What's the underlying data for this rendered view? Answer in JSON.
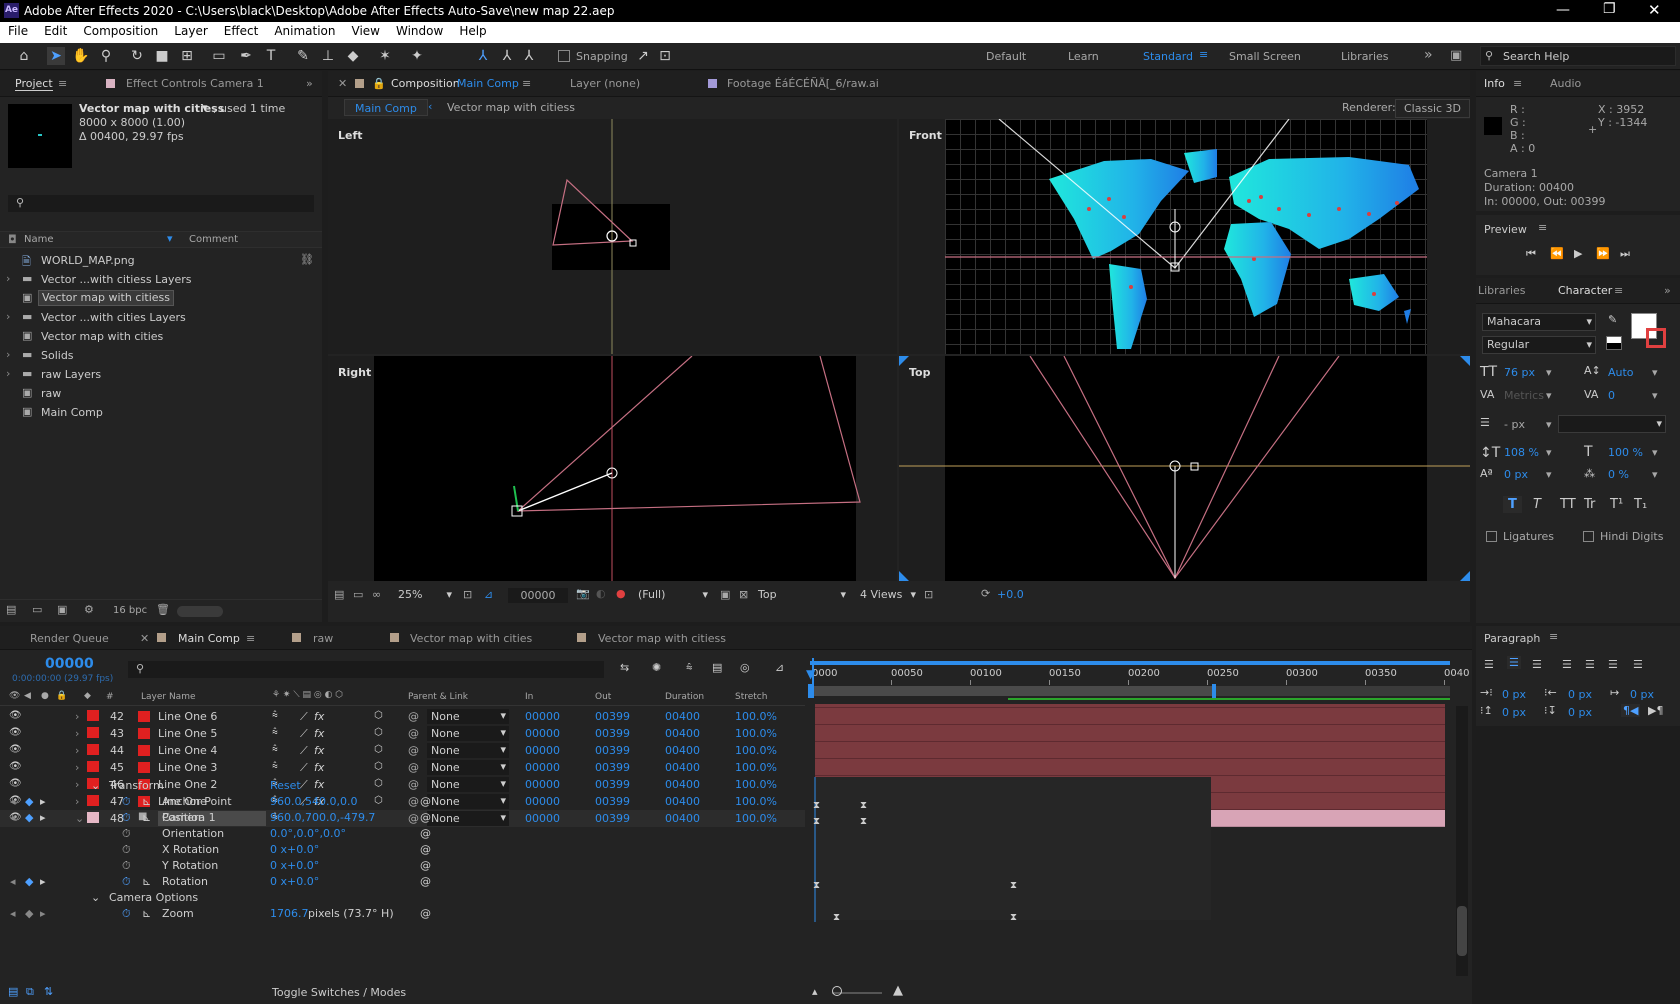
{
  "window": {
    "title": "Adobe After Effects 2020 - C:\\Users\\black\\Desktop\\Adobe After Effects Auto-Save\\new map 22.aep",
    "app_badge": "Ae"
  },
  "menu": [
    "File",
    "Edit",
    "Composition",
    "Layer",
    "Effect",
    "Animation",
    "View",
    "Window",
    "Help"
  ],
  "toolbar": {
    "snapping": "Snapping",
    "workspaces": [
      "Default",
      "Learn",
      "Standard",
      "Small Screen",
      "Libraries"
    ],
    "active_workspace": "Standard",
    "search_placeholder": "Search Help"
  },
  "project": {
    "tab": "Project",
    "effect_controls_tab": "Effect Controls Camera 1",
    "selected_name": "Vector map with citiess",
    "used": ", used 1 time",
    "dims": "8000 x 8000 (1.00)",
    "duration": "Δ 00400, 29.97 fps",
    "col_name": "Name",
    "col_comment": "Comment",
    "items": [
      "WORLD_MAP.png",
      "Vector ...with citiess Layers",
      "Vector map with citiess",
      "Vector ...with cities Layers",
      "Vector map with cities",
      "Solids",
      "raw Layers",
      "raw",
      "Main Comp"
    ],
    "bpc": "16 bpc"
  },
  "composition": {
    "tab_prefix": "Composition",
    "tab_name": "Main Comp",
    "layer_tab": "Layer  (none)",
    "footage_tab": "Footage  ÉáÉCÉÑÄ[_6/raw.ai",
    "crumb1": "Main Comp",
    "crumb2": "Vector map with citiess",
    "renderer_label": "Renderer:",
    "renderer": "Classic 3D",
    "views": [
      "Left",
      "Front",
      "Right",
      "Top"
    ],
    "zoom": "25%",
    "timecode": "00000",
    "resolution": "(Full)",
    "view": "Top",
    "layout": "4 Views",
    "exposure": "+0.0"
  },
  "info": {
    "tab": "Info",
    "audio_tab": "Audio",
    "r": "R :",
    "g": "G :",
    "b": "B :",
    "a": "A :  0",
    "x": "X : 3952",
    "y": "Y : -1344",
    "camera": "Camera 1",
    "duration": "Duration: 00400",
    "inout": "In: 00000, Out: 00399",
    "preview": "Preview"
  },
  "character": {
    "libraries_tab": "Libraries",
    "tab": "Character",
    "font": "Mahacara",
    "style": "Regular",
    "size": "76 px",
    "leading": "Auto",
    "kerning": "Metrics",
    "tracking": "0",
    "stroke": "- px",
    "vscale": "108 %",
    "hscale": "100 %",
    "baseline": "0 px",
    "tsume": "0 %",
    "ligatures": "Ligatures",
    "hindi": "Hindi Digits",
    "styles": [
      "T",
      "T",
      "TT",
      "Tr",
      "T¹",
      "T₁"
    ]
  },
  "paragraph": {
    "tab": "Paragraph",
    "values": [
      "0 px",
      "0 px",
      "0 px",
      "0 px",
      "0 px"
    ]
  },
  "timeline": {
    "tabs": [
      "Render Queue",
      "Main Comp",
      "raw",
      "Vector map with cities",
      "Vector map with citiess"
    ],
    "timecode": "00000",
    "fps": "0:00:00:00 (29.97 fps)",
    "cols": {
      "layer": "Layer Name",
      "parent": "Parent & Link",
      "in": "In",
      "out": "Out",
      "duration": "Duration",
      "stretch": "Stretch"
    },
    "ruler": [
      "0000",
      "00050",
      "00100",
      "00150",
      "00200",
      "00250",
      "00300",
      "00350",
      "0040"
    ],
    "layers": [
      {
        "num": "42",
        "name": "Line One 6",
        "parent": "None",
        "in": "00000",
        "out": "00399",
        "dur": "00400",
        "stretch": "100.0%"
      },
      {
        "num": "43",
        "name": "Line One 5",
        "parent": "None",
        "in": "00000",
        "out": "00399",
        "dur": "00400",
        "stretch": "100.0%"
      },
      {
        "num": "44",
        "name": "Line One 4",
        "parent": "None",
        "in": "00000",
        "out": "00399",
        "dur": "00400",
        "stretch": "100.0%"
      },
      {
        "num": "45",
        "name": "Line One 3",
        "parent": "None",
        "in": "00000",
        "out": "00399",
        "dur": "00400",
        "stretch": "100.0%"
      },
      {
        "num": "46",
        "name": "Line One 2",
        "parent": "None",
        "in": "00000",
        "out": "00399",
        "dur": "00400",
        "stretch": "100.0%"
      },
      {
        "num": "47",
        "name": "Line One",
        "parent": "None",
        "in": "00000",
        "out": "00399",
        "dur": "00400",
        "stretch": "100.0%"
      },
      {
        "num": "48",
        "name": "Camera 1",
        "parent": "None",
        "in": "00000",
        "out": "00399",
        "dur": "00400",
        "stretch": "100.0%"
      }
    ],
    "transform": "Transform",
    "reset": "Reset",
    "props": [
      {
        "name": "Anchor Point",
        "value": "960.0,540.0,0.0"
      },
      {
        "name": "Position",
        "value": "960.0,700.0,-479.7"
      },
      {
        "name": "Orientation",
        "value": "0.0°,0.0°,0.0°"
      },
      {
        "name": "X Rotation",
        "value": "0 x+0.0°"
      },
      {
        "name": "Y Rotation",
        "value": "0 x+0.0°"
      },
      {
        "name": "Rotation",
        "value": "0 x+0.0°"
      }
    ],
    "camera_options": "Camera Options",
    "zoom_name": "Zoom",
    "zoom_value": "1706.7",
    "zoom_unit": "pixels (73.7° H)",
    "toggle": "Toggle Switches / Modes"
  }
}
